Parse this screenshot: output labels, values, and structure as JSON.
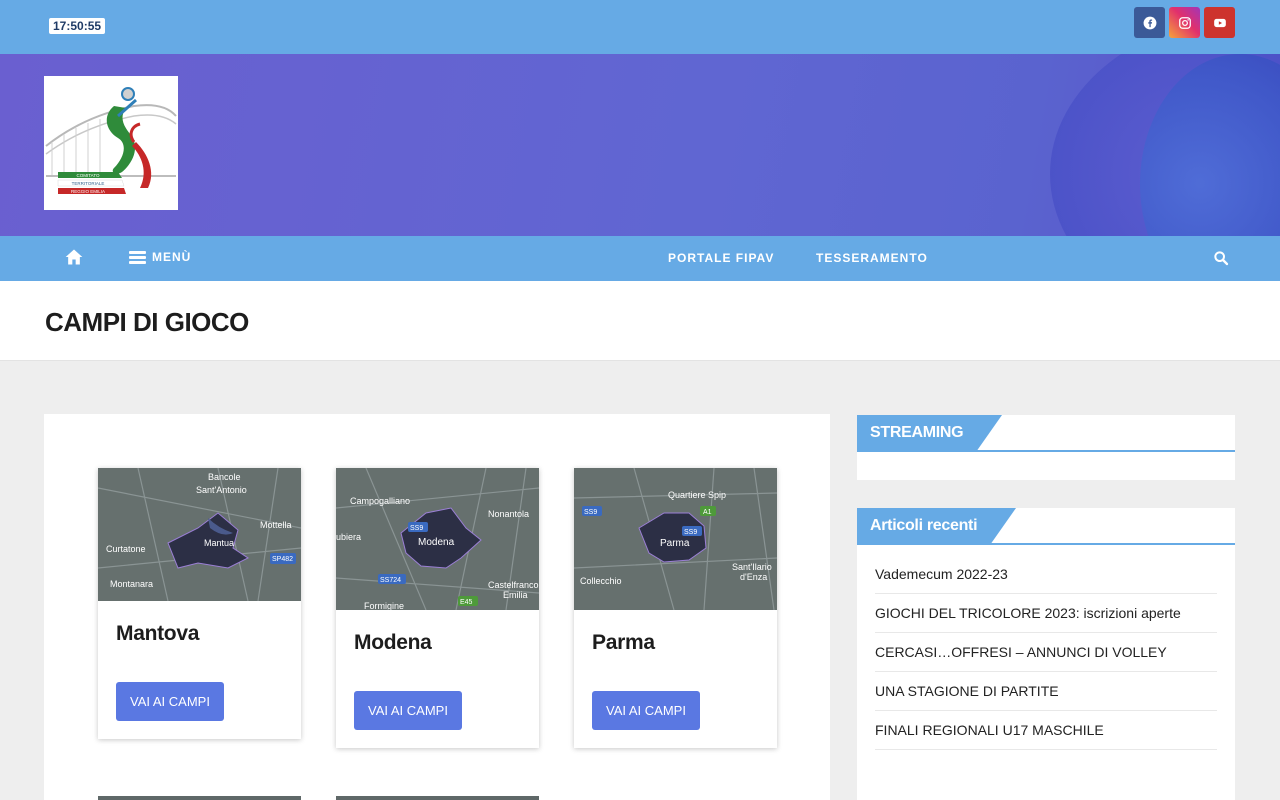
{
  "topbar": {
    "clock": "17:50:55",
    "social": [
      {
        "name": "facebook-icon",
        "color": "#3b5a98"
      },
      {
        "name": "instagram-icon",
        "color": "#e1306c"
      },
      {
        "name": "youtube-icon",
        "color": "#cd332d"
      }
    ]
  },
  "header": {
    "logo_lines": [
      "COMITATO",
      "TERRITORIALE",
      "REGGIO EMILIA"
    ]
  },
  "nav": {
    "menu_label": "MENÙ",
    "links": [
      "PORTALE FIPAV",
      "TESSERAMENTO"
    ]
  },
  "page": {
    "title": "CAMPI DI GIOCO"
  },
  "cards": [
    {
      "city": "Mantova",
      "button": "VAI AI CAMPI",
      "map_labels": [
        "Bancole",
        "Sant'Antonio",
        "Mottella",
        "Curtatone",
        "Mantua",
        "SP482",
        "Montanara"
      ]
    },
    {
      "city": "Modena",
      "button": "VAI AI CAMPI",
      "map_labels": [
        "Campogalliano",
        "Nonantola",
        "SS9",
        "ubiera",
        "Modena",
        "SS724",
        "Castelfranco",
        "Emilia",
        "Formigine",
        "E45"
      ]
    },
    {
      "city": "Parma",
      "button": "VAI AI CAMPI",
      "map_labels": [
        "Quartiere Spip",
        "SS9",
        "A1",
        "SS9",
        "Parma",
        "Sant'Ilario",
        "d'Enza",
        "Collecchio"
      ]
    }
  ],
  "sidebar": {
    "streaming_title": "STREAMING",
    "recent_title": "Articoli recenti",
    "recent_items": [
      "Vademecum 2022-23",
      "GIOCHI DEL TRICOLORE 2023: iscrizioni aperte",
      "CERCASI…OFFRESI – ANNUNCI DI VOLLEY",
      "UNA STAGIONE DI PARTITE",
      "FINALI REGIONALI U17 MASCHILE"
    ]
  },
  "colors": {
    "topbar": "#66aae5",
    "header": "#6066d2",
    "button": "#5a78e2"
  }
}
